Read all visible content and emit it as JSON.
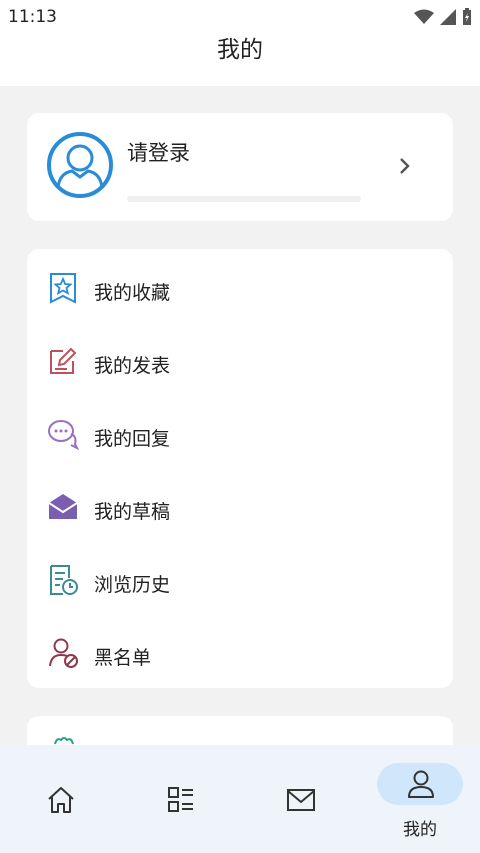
{
  "status": {
    "time": "11:13"
  },
  "header": {
    "title": "我的"
  },
  "profile": {
    "login_label": "请登录"
  },
  "menu": {
    "items": [
      {
        "label": "我的收藏",
        "icon": "star-bookmark-icon"
      },
      {
        "label": "我的发表",
        "icon": "edit-icon"
      },
      {
        "label": "我的回复",
        "icon": "chat-bubble-icon"
      },
      {
        "label": "我的草稿",
        "icon": "envelope-open-icon"
      },
      {
        "label": "浏览历史",
        "icon": "history-doc-icon"
      },
      {
        "label": "黑名单",
        "icon": "user-block-icon"
      }
    ]
  },
  "bottom_nav": {
    "items": [
      {
        "label": "",
        "icon": "home-icon"
      },
      {
        "label": "",
        "icon": "list-icon"
      },
      {
        "label": "",
        "icon": "mail-icon"
      },
      {
        "label": "我的",
        "icon": "user-icon",
        "active": true
      }
    ]
  },
  "colors": {
    "accent": "#2a8bd6",
    "nav_bg": "#eef4fa",
    "pill": "#cfe6fb"
  }
}
